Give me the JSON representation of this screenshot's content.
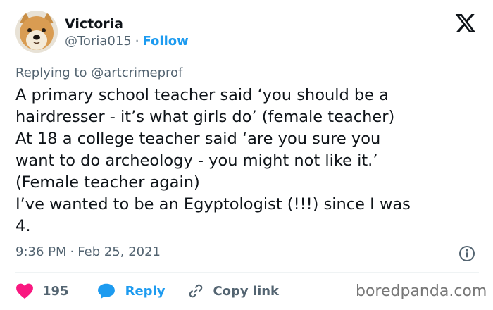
{
  "author": {
    "name": "Victoria",
    "handle": "@Toria015",
    "separator": "·",
    "follow_label": "Follow"
  },
  "reply_to": "Replying to @artcrimeprof",
  "body_lines": [
    "A primary school teacher said ‘you should be a",
    "hairdresser - it’s what girls do’ (female teacher)",
    "At 18 a college teacher said ‘are you sure you",
    "want to do archeology - you might not like it.’",
    "(Female teacher again)",
    "I’ve wanted to be an Egyptologist (!!!) since I was",
    "4."
  ],
  "timestamp": {
    "time": "9:36 PM",
    "separator": "·",
    "date": "Feb 25, 2021"
  },
  "actions": {
    "likes_count": "195",
    "reply_label": "Reply",
    "copy_link_label": "Copy link"
  },
  "watermark": "boredpanda.com",
  "icons": {
    "brand": "x-logo-icon",
    "info": "info-icon",
    "like": "heart-icon",
    "reply": "speech-bubble-icon",
    "copy": "link-icon"
  },
  "colors": {
    "text": "#0f1419",
    "secondary": "#536471",
    "link": "#1d9bf0",
    "like": "#f91880",
    "divider": "#eff3f4"
  }
}
